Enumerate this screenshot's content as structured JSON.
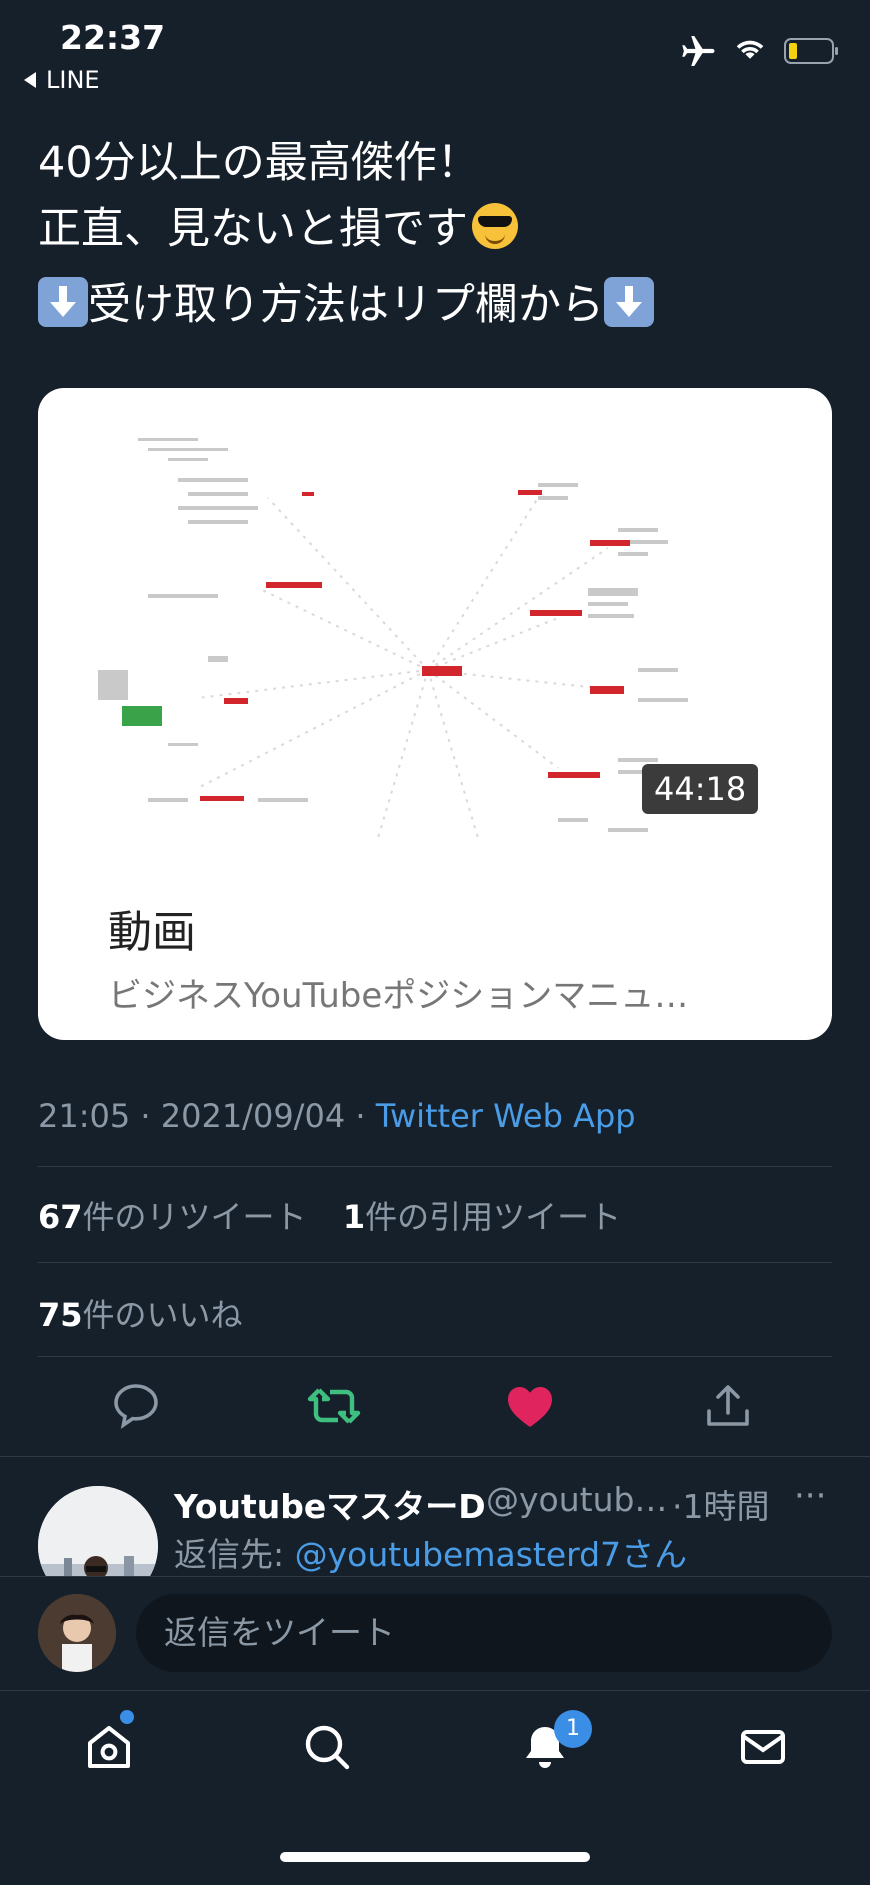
{
  "status_bar": {
    "time": "22:37",
    "back_app": "LINE"
  },
  "tweet": {
    "lines": [
      "40分以上の最高傑作！",
      "正直、見ないと損です"
    ],
    "line3": "受け取り方法はリプ欄から"
  },
  "card": {
    "duration": "44:18",
    "title": "動画",
    "description": "ビジネスYouTubeポジションマニュ…"
  },
  "meta": {
    "time": "21:05",
    "date": "2021/09/04",
    "separator": "·",
    "app": "Twitter Web App"
  },
  "stats": {
    "retweets_count": "67",
    "retweets_label": "件のリツイート",
    "quotes_count": "1",
    "quotes_label": "件の引用ツイート",
    "likes_count": "75",
    "likes_label": "件のいいね"
  },
  "actions": [
    "reply-icon",
    "retweet-icon",
    "like-icon",
    "share-icon"
  ],
  "colors": {
    "background": "#16202b",
    "accent_blue": "#4a9ce6",
    "retweet_green": "#3fbf7f",
    "like_red": "#e0245e"
  },
  "reply": {
    "name": "YoutubeマスターD",
    "handle": "@youtub…",
    "time": "·1時間",
    "more": "···",
    "reply_to_label": "返信先: ",
    "reply_to_handle": "@youtubemasterd7さん"
  },
  "compose": {
    "placeholder": "返信をツイート"
  },
  "tabbar": {
    "notifications_badge": "1"
  }
}
